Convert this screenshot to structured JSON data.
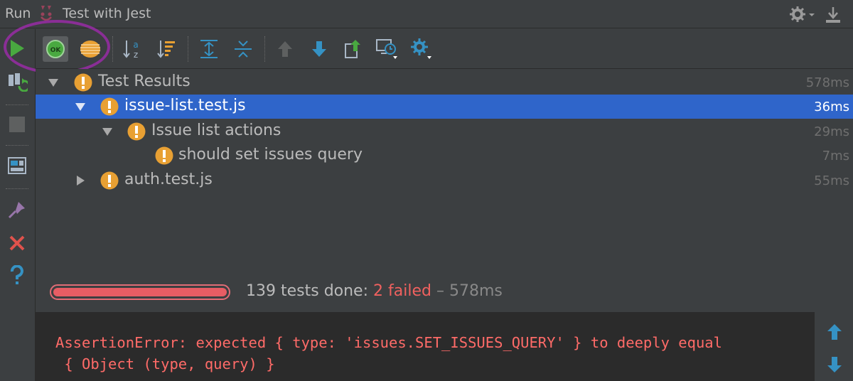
{
  "window": {
    "run_label": "Run",
    "config_name": "Test with Jest"
  },
  "icons": {
    "accent_green": "#49a940",
    "accent_blue": "#3592c4",
    "warning_orange": "#e8a033",
    "error_red": "#e0524c",
    "selection_blue": "#2f65ca"
  },
  "toolbar": {
    "show_passed_label": "OK"
  },
  "tree": {
    "rows": [
      {
        "label": "Test Results",
        "time": "578ms",
        "expanded": true,
        "selected": false
      },
      {
        "label": "issue-list.test.js",
        "time": "36ms",
        "expanded": true,
        "selected": true
      },
      {
        "label": "Issue list actions",
        "time": "29ms",
        "expanded": true,
        "selected": false
      },
      {
        "label": "should set issues query",
        "time": "7ms",
        "leaf": true,
        "selected": false
      },
      {
        "label": "auth.test.js",
        "time": "55ms",
        "expanded": false,
        "selected": false
      }
    ]
  },
  "status": {
    "tests_done": "139 tests done:",
    "failed": "2 failed",
    "dash": "–",
    "total_time": "578ms",
    "progress_fraction": 1.0
  },
  "console": {
    "line1": "AssertionError: expected { type: 'issues.SET_ISSUES_QUERY' } to deeply equal",
    "line2": " { Object (type, query) }"
  }
}
